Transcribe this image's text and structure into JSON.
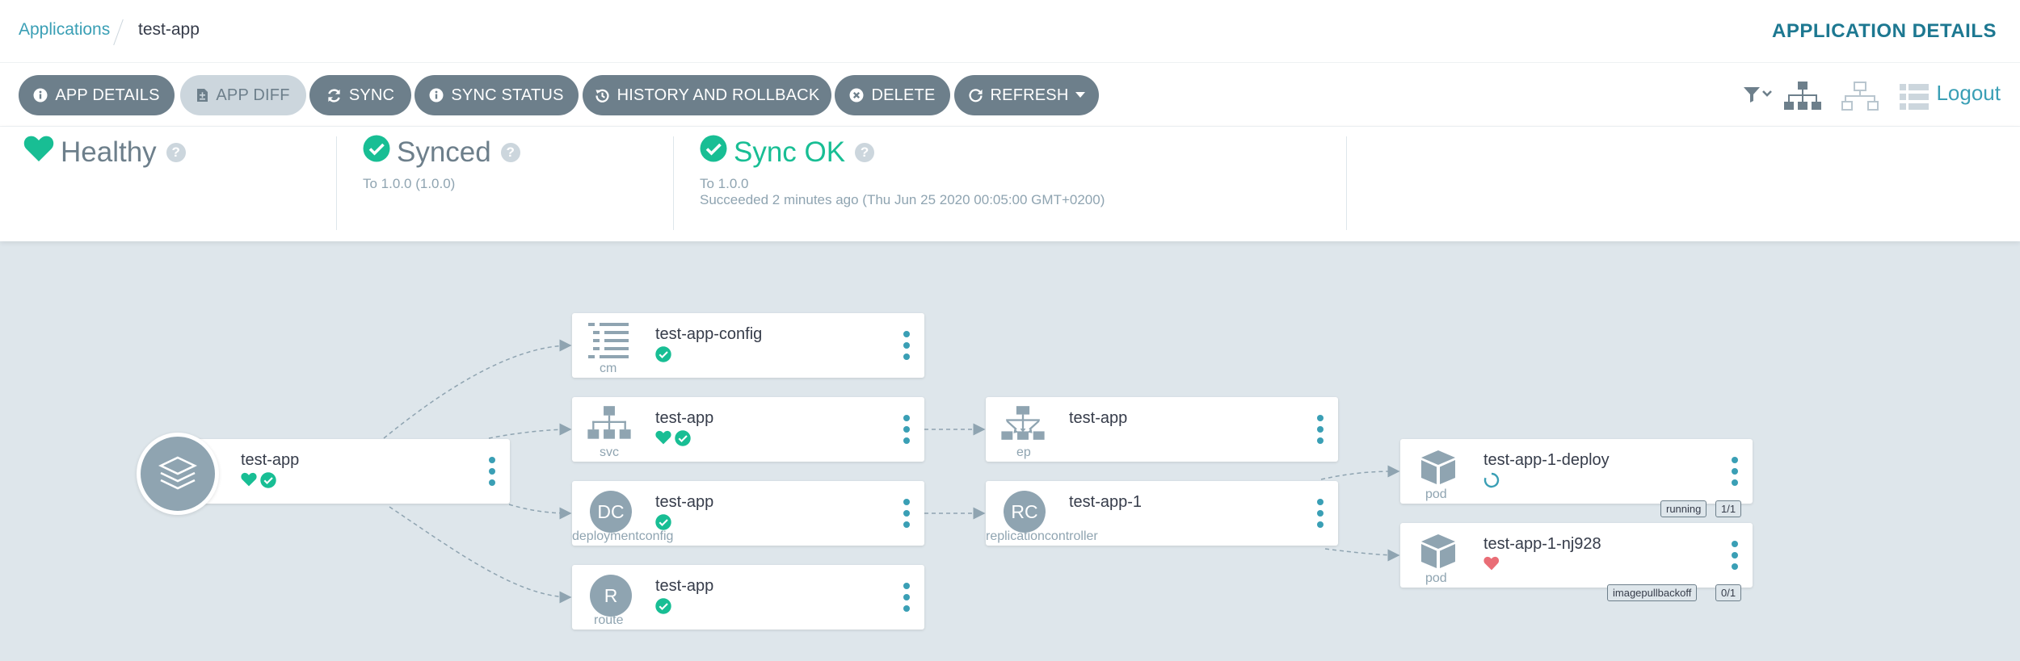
{
  "breadcrumb": {
    "applications": "Applications",
    "current": "test-app"
  },
  "page_title": "APPLICATION DETAILS",
  "toolbar": {
    "app_details": "APP DETAILS",
    "app_diff": "APP DIFF",
    "sync": "SYNC",
    "sync_status": "SYNC STATUS",
    "history": "HISTORY AND ROLLBACK",
    "delete": "DELETE",
    "refresh": "REFRESH",
    "logout": "Logout"
  },
  "status": {
    "health": "Healthy",
    "sync": "Synced",
    "sync_to": "To 1.0.0 (1.0.0)",
    "op": "Sync OK",
    "op_to": "To 1.0.0",
    "op_detail": "Succeeded 2 minutes ago (Thu Jun 25 2020 00:05:00 GMT+0200)"
  },
  "graph": {
    "app": {
      "name": "test-app"
    },
    "config": {
      "name": "test-app-config",
      "kind": "cm"
    },
    "svc": {
      "name": "test-app",
      "kind": "svc"
    },
    "dc": {
      "name": "test-app",
      "kind": "deploymentconfig",
      "abbr": "DC"
    },
    "route": {
      "name": "test-app",
      "kind": "route",
      "abbr": "R"
    },
    "ep": {
      "name": "test-app",
      "kind": "ep"
    },
    "rc": {
      "name": "test-app-1",
      "kind": "replicationcontroller",
      "abbr": "RC"
    },
    "pod1": {
      "name": "test-app-1-deploy",
      "kind": "pod",
      "status": "running",
      "ready": "1/1"
    },
    "pod2": {
      "name": "test-app-1-nj928",
      "kind": "pod",
      "status": "imagepullbackoff",
      "ready": "0/1"
    }
  },
  "colors": {
    "accent": "#3a9fb5",
    "healthy": "#18be94",
    "button": "#6d7f8b",
    "degraded": "#e96d76",
    "title": "#1d7891"
  }
}
